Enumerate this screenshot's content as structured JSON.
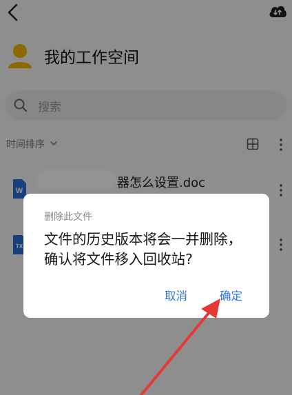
{
  "workspace": {
    "title": "我的工作空间"
  },
  "search": {
    "placeholder": "搜索"
  },
  "sort": {
    "label": "时间排序"
  },
  "files": [
    {
      "name": "器怎么设置.doc",
      "icon": "word-doc-icon",
      "badge": "W",
      "color": "#2b6fd6"
    },
    {
      "name": "",
      "icon": "txt-file-icon",
      "badge": "TX",
      "color": "#2b6fd6"
    }
  ],
  "dialog": {
    "title": "删除此文件",
    "message": "文件的历史版本将会一并删除，确认将文件移入回收站?",
    "cancel_label": "取消",
    "confirm_label": "确定"
  },
  "colors": {
    "accent": "#2f73e0",
    "annotation": "#e53935",
    "avatar": "#f2b400"
  }
}
